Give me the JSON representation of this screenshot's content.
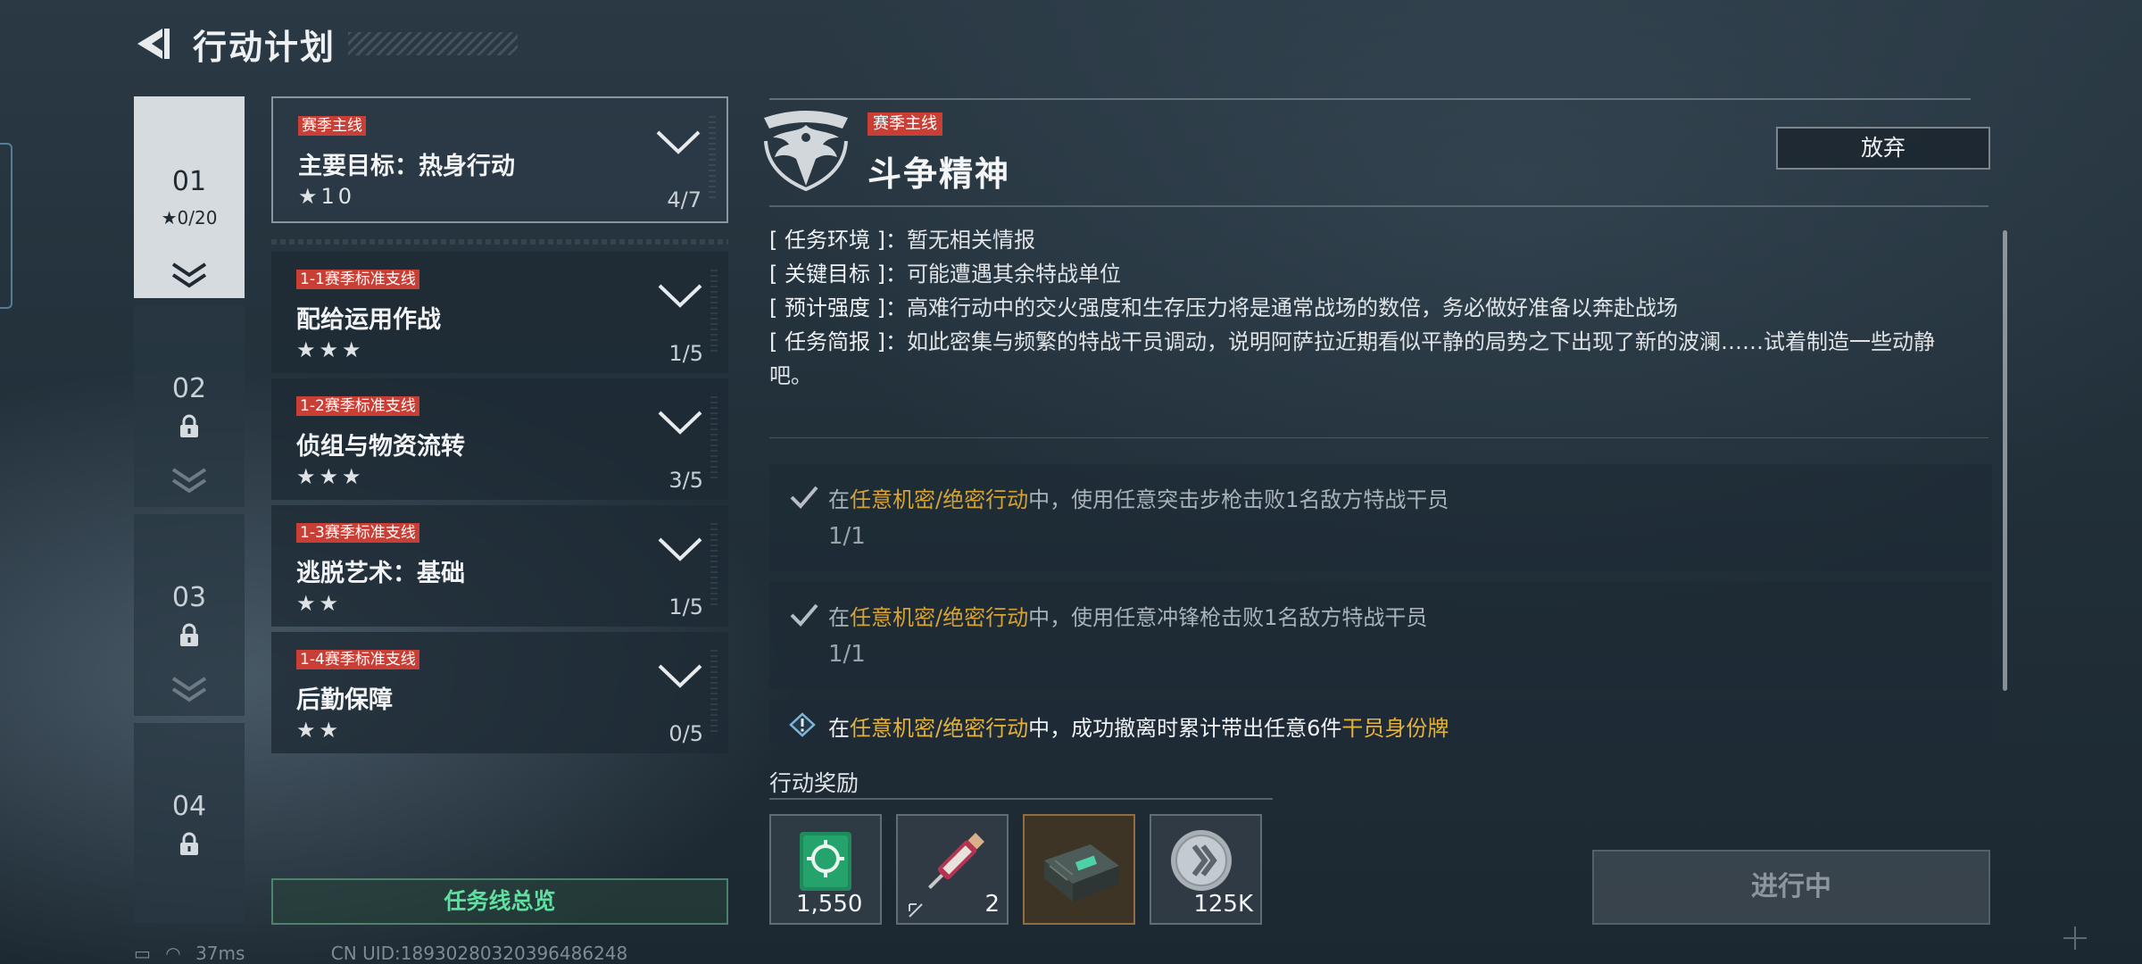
{
  "header": {
    "title": "行动计划",
    "back_icon": "back-arrow-icon"
  },
  "chapters": [
    {
      "number": "01",
      "stars": "★0/20",
      "locked": false,
      "selected": true
    },
    {
      "number": "02",
      "locked": true
    },
    {
      "number": "03",
      "locked": true
    },
    {
      "number": "04",
      "locked": true
    }
  ],
  "missions": [
    {
      "tag": "赛季主线",
      "name": "主要目标：热身行动",
      "stars": "★10",
      "progress": "4/7",
      "selected": true
    },
    {
      "tag": "1-1赛季标准支线",
      "name": "配给运用作战",
      "stars": "★★★",
      "progress": "1/5"
    },
    {
      "tag": "1-2赛季标准支线",
      "name": "侦组与物资流转",
      "stars": "★★★",
      "progress": "3/5"
    },
    {
      "tag": "1-3赛季标准支线",
      "name": "逃脱艺术：基础",
      "stars": "★★",
      "progress": "1/5"
    },
    {
      "tag": "1-4赛季标准支线",
      "name": "后勤保障",
      "stars": "★★",
      "progress": "0/5"
    }
  ],
  "overview_button": "任务线总览",
  "detail": {
    "tag": "赛季主线",
    "title": "斗争精神",
    "abandon_label": "放弃",
    "info": [
      {
        "key": "[ 任务环境 ]：",
        "value": "暂无相关情报"
      },
      {
        "key": "[ 关键目标 ]：",
        "value": "可能遭遇其余特战单位"
      },
      {
        "key": "[ 预计强度 ]：",
        "value": "高难行动中的交火强度和生存压力将是通常战场的数倍，务必做好准备以奔赴战场"
      },
      {
        "key": "[ 任务简报 ]：",
        "value": "如此密集与频繁的特战干员调动，说明阿萨拉近期看似平静的局势之下出现了新的波澜……试着制造一些动静吧。"
      }
    ],
    "objectives": [
      {
        "pre": "在",
        "hl": "任意机密/绝密行动",
        "post": "中，使用任意突击步枪击败1名敌方特战干员",
        "hl2": "",
        "count": "1/1",
        "done": true
      },
      {
        "pre": "在",
        "hl": "任意机密/绝密行动",
        "post": "中，使用任意冲锋枪击败1名敌方特战干员",
        "hl2": "",
        "count": "1/1",
        "done": true
      },
      {
        "pre": "在",
        "hl": "任意机密/绝密行动",
        "post": "中，成功撤离时累计带出任意6件",
        "hl2": "干员身份牌",
        "count": "",
        "done": false
      }
    ]
  },
  "rewards": {
    "label": "行动奖励",
    "items": [
      {
        "icon": "supply-box-icon",
        "qty": "1,550"
      },
      {
        "icon": "syringe-icon",
        "qty": "2"
      },
      {
        "icon": "ammo-case-icon",
        "qty": ""
      },
      {
        "icon": "coin-icon",
        "qty": "125K"
      }
    ]
  },
  "in_progress_label": "进行中",
  "status": {
    "ping": "37ms",
    "uid": "CN UID:18930280320396486248"
  },
  "colors": {
    "tag_red": "#c93f35",
    "highlight_gold": "#d6a233",
    "overview_green": "#5fe0a0"
  }
}
